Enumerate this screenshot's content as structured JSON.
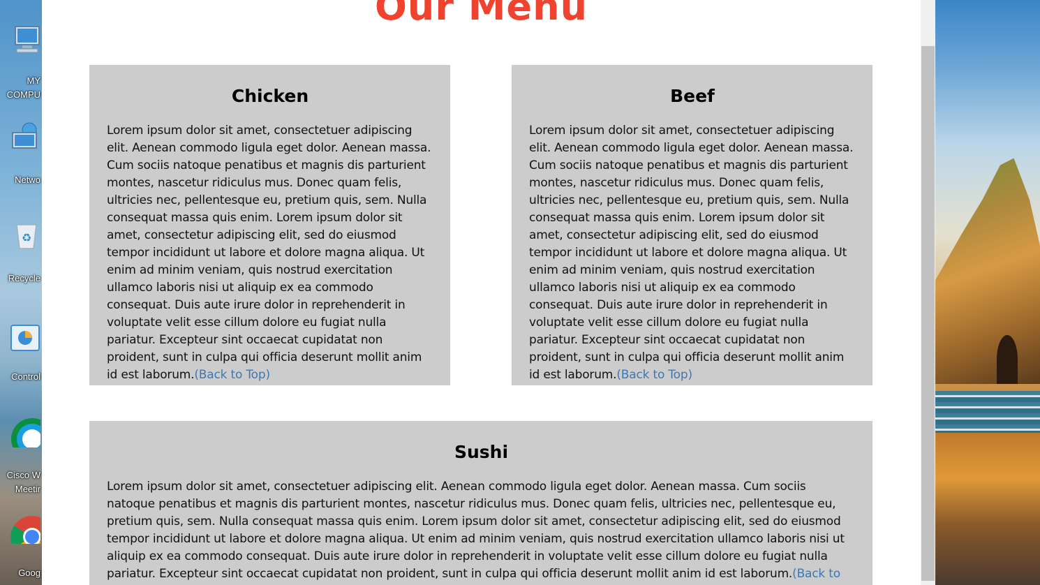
{
  "desktop": {
    "icons": [
      {
        "label": "MY",
        "icon": "computer-icon"
      },
      {
        "label": "COMPU",
        "icon": "computer-icon"
      },
      {
        "label": "Netwo",
        "icon": "network-icon"
      },
      {
        "label": "Recycle",
        "icon": "recycle-bin-icon"
      },
      {
        "label": "Control",
        "icon": "control-panel-icon"
      },
      {
        "label": "Cisco W",
        "icon": "cisco-webex-icon"
      },
      {
        "label": "Meetir",
        "icon": "cisco-webex-icon"
      },
      {
        "label": "Goog",
        "icon": "chrome-icon"
      }
    ]
  },
  "page": {
    "title": "Our Menu",
    "cards": [
      {
        "title": "Chicken",
        "body": "Lorem ipsum dolor sit amet, consectetuer adipiscing elit. Aenean commodo ligula eget dolor. Aenean massa. Cum sociis natoque penatibus et magnis dis parturient montes, nascetur ridiculus mus. Donec quam felis, ultricies nec, pellentesque eu, pretium quis, sem. Nulla consequat massa quis enim. Lorem ipsum dolor sit amet, consectetur adipiscing elit, sed do eiusmod tempor incididunt ut labore et dolore magna aliqua. Ut enim ad minim veniam, quis nostrud exercitation ullamco laboris nisi ut aliquip ex ea commodo consequat. Duis aute irure dolor in reprehenderit in voluptate velit esse cillum dolore eu fugiat nulla pariatur. Excepteur sint occaecat cupidatat non proident, sunt in culpa qui officia deserunt mollit anim id est laborum.",
        "link": "(Back to Top)"
      },
      {
        "title": "Beef",
        "body": "Lorem ipsum dolor sit amet, consectetuer adipiscing elit. Aenean commodo ligula eget dolor. Aenean massa. Cum sociis natoque penatibus et magnis dis parturient montes, nascetur ridiculus mus. Donec quam felis, ultricies nec, pellentesque eu, pretium quis, sem. Nulla consequat massa quis enim. Lorem ipsum dolor sit amet, consectetur adipiscing elit, sed do eiusmod tempor incididunt ut labore et dolore magna aliqua. Ut enim ad minim veniam, quis nostrud exercitation ullamco laboris nisi ut aliquip ex ea commodo consequat. Duis aute irure dolor in reprehenderit in voluptate velit esse cillum dolore eu fugiat nulla pariatur. Excepteur sint occaecat cupidatat non proident, sunt in culpa qui officia deserunt mollit anim id est laborum.",
        "link": "(Back to Top)"
      },
      {
        "title": "Sushi",
        "body": "Lorem ipsum dolor sit amet, consectetuer adipiscing elit. Aenean commodo ligula eget dolor. Aenean massa. Cum sociis natoque penatibus et magnis dis parturient montes, nascetur ridiculus mus. Donec quam felis, ultricies nec, pellentesque eu, pretium quis, sem. Nulla consequat massa quis enim. Lorem ipsum dolor sit amet, consectetur adipiscing elit, sed do eiusmod tempor incididunt ut labore et dolore magna aliqua. Ut enim ad minim veniam, quis nostrud exercitation ullamco laboris nisi ut aliquip ex ea commodo consequat. Duis aute irure dolor in reprehenderit in voluptate velit esse cillum dolore eu fugiat nulla pariatur. Excepteur sint occaecat cupidatat non proident, sunt in culpa qui officia deserunt mollit anim id est laborum.",
        "link": "(Back to Top)"
      }
    ]
  },
  "colors": {
    "title": "#f0432f",
    "card_bg": "#cccccc",
    "link": "#3b78b5"
  }
}
